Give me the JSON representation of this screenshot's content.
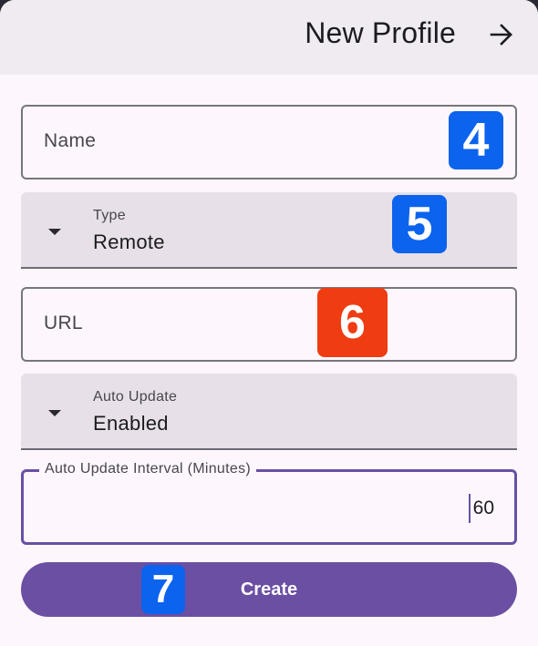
{
  "header": {
    "title": "New Profile",
    "forward_icon": "arrow-right-icon"
  },
  "form": {
    "name_placeholder": "Name",
    "type": {
      "label": "Type",
      "value": "Remote"
    },
    "url_placeholder": "URL",
    "auto_update": {
      "label": "Auto Update",
      "value": "Enabled"
    },
    "interval": {
      "label": "Auto Update Interval (Minutes)",
      "value": "60"
    }
  },
  "create_label": "Create",
  "annotations": [
    "4",
    "5",
    "6",
    "7"
  ],
  "colors": {
    "primary": "#6750a4",
    "button": "#6b4fa3",
    "badge_blue": "#0b63ee",
    "badge_red": "#ef3c12"
  }
}
